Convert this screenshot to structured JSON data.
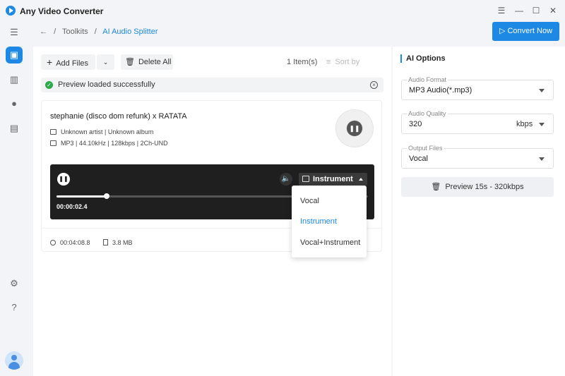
{
  "app": {
    "title": "Any Video Converter"
  },
  "breadcrumb": {
    "parent": "Toolkits",
    "current": "AI Audio Splitter",
    "separator": "/"
  },
  "header": {
    "convert_label": "Convert Now"
  },
  "toolbar": {
    "add_files_label": "Add Files",
    "delete_all_label": "Delete All",
    "item_count": "1 Item(s)",
    "sort_label": "Sort by"
  },
  "notice": {
    "text": "Preview loaded successfully"
  },
  "file": {
    "title": "stephanie (disco dom refunk) x RATATA",
    "artist_album": "Unknown artist | Unknown album",
    "tech_info": "MP3 | 44.10kHz | 128kbps | 2Ch-UND",
    "duration": "00:04:08.8",
    "size": "3.8 MB"
  },
  "player": {
    "current_time": "00:00:02.4",
    "progress": 0.16,
    "mode_label": "Instrument"
  },
  "mode_dropdown": {
    "options": [
      "Vocal",
      "Instrument",
      "Vocal+Instrument"
    ],
    "selected": "Instrument"
  },
  "ai_options": {
    "title": "AI Options",
    "audio_format_label": "Audio Format",
    "audio_format_value": "MP3 Audio(*.mp3)",
    "audio_quality_label": "Audio Quality",
    "audio_quality_value": "320",
    "audio_quality_unit": "kbps",
    "output_files_label": "Output Files",
    "output_files_value": "Vocal",
    "preview_label": "Preview 15s - 320kbps"
  },
  "colors": {
    "accent": "#1e88e5",
    "success": "#2eaa4a",
    "player_bg": "#1f1f1f"
  }
}
